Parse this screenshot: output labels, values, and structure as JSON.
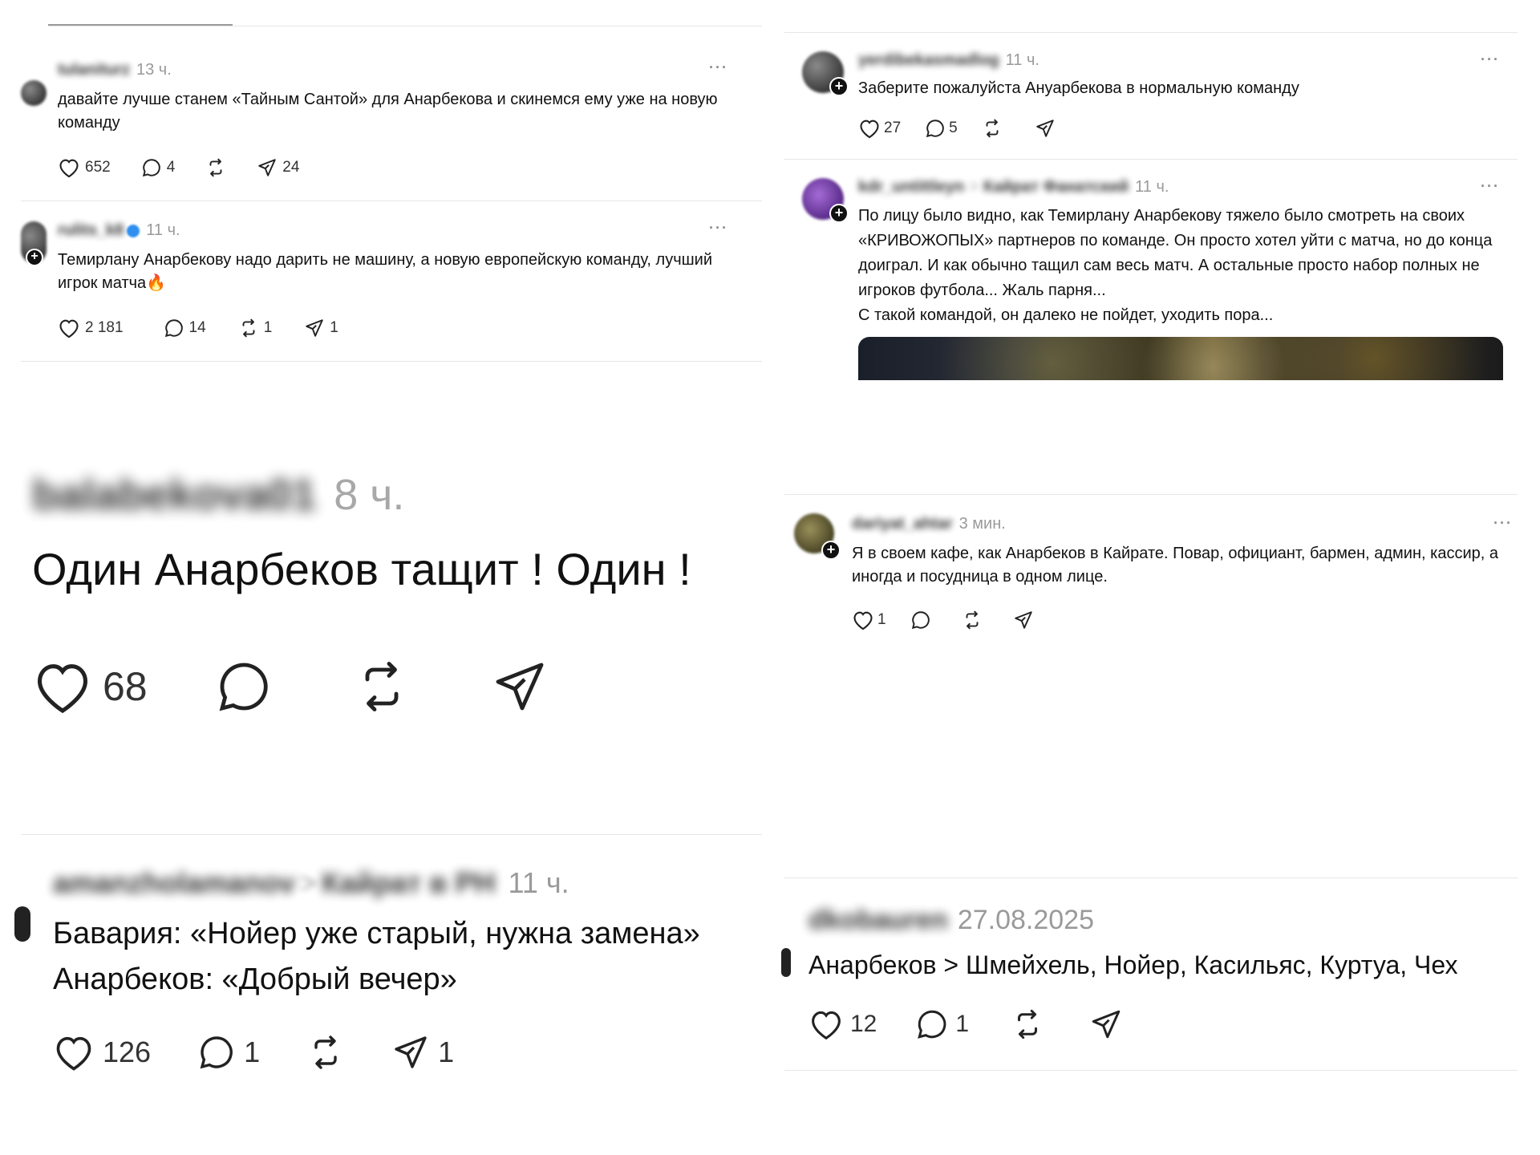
{
  "posts": [
    {
      "username": "tulaniturz",
      "time": "13 ч.",
      "more": "···",
      "text": "давайте лучше станем «Тайным Сантой» для Анарбекова и скинемся ему уже на новую команду",
      "likes": "652",
      "replies": "4",
      "reposts": "",
      "shares": "24"
    },
    {
      "username": "rulits_k8",
      "time": "11 ч.",
      "more": "···",
      "text": "Темирлану Анарбекову надо дарить не машину, а новую европейскую команду, лучший игрок матча🔥",
      "likes": "2 181",
      "replies": "14",
      "reposts": "1",
      "shares": "1"
    },
    {
      "username": "balabekova01",
      "time": "8 ч.",
      "text": "Один Анарбеков тащит ! Один !",
      "likes": "68",
      "replies": "",
      "reposts": "",
      "shares": ""
    },
    {
      "username": "amanzholamanov",
      "community": "Кайрат в РН",
      "time": "11 ч.",
      "text": "Бавария: «Нойер уже старый, нужна замена»\nАнарбеков: «Добрый вечер»",
      "likes": "126",
      "replies": "1",
      "reposts": "",
      "shares": "1"
    },
    {
      "username": "yerdibekasmadlog",
      "time": "11 ч.",
      "more": "···",
      "text": "Заберите пожалуйста Ануарбекова в нормальную команду",
      "likes": "27",
      "replies": "5",
      "reposts": "",
      "shares": ""
    },
    {
      "username": "kdr_untittleyn",
      "community": "Кайрат Фанатский",
      "time": "11 ч.",
      "more": "···",
      "text": "По лицу было видно, как Темирлану Анарбекову тяжело было смотреть на своих «КРИВОЖОПЫХ» партнеров по команде. Он просто хотел уйти с матча, но до конца доиграл. И как обычно тащил сам весь матч. А остальные просто набор полных не игроков футбола... Жаль парня...\nС такой командой, он далеко не пойдет, уходить пора..."
    },
    {
      "username": "dariyat_ahtar",
      "time": "3 мин.",
      "more": "···",
      "text": "Я в своем кафе, как Анарбеков в Кайрате. Повар, официант, бармен, админ, кассир, а иногда и посудница в одном лице.",
      "likes": "1",
      "replies": "",
      "reposts": "",
      "shares": ""
    },
    {
      "username": "dkobauren",
      "time": "27.08.2025",
      "text": "Анарбеков > Шмейхель, Нойер, Касильяс, Куртуа, Чех",
      "likes": "12",
      "replies": "1",
      "reposts": "",
      "shares": ""
    }
  ],
  "icons": [
    "heart-icon",
    "comment-icon",
    "repost-icon",
    "share-icon",
    "plus-icon"
  ]
}
